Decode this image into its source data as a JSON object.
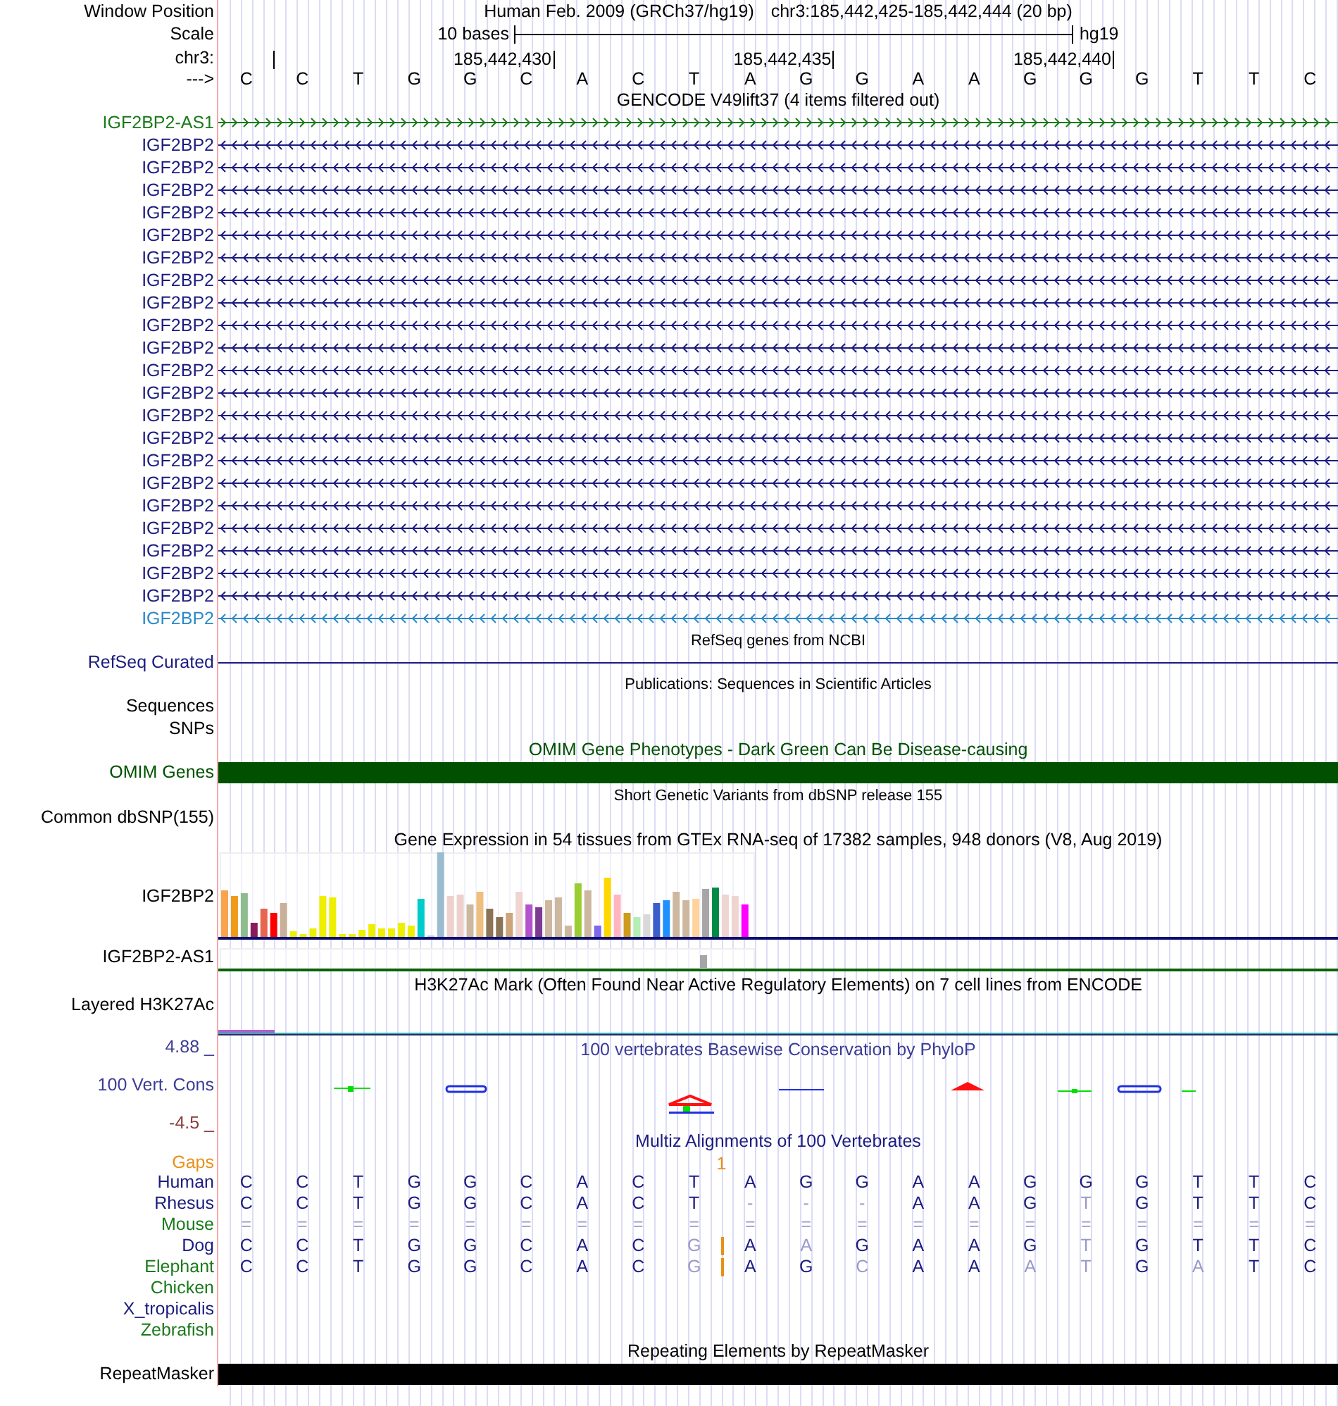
{
  "header": {
    "window_position": {
      "label": "Window Position",
      "assembly": "Human Feb. 2009 (GRCh37/hg19)",
      "position": "chr3:185,442,425-185,442,444 (20 bp)"
    },
    "scale": {
      "label": "Scale",
      "span": "10 bases",
      "assembly": "hg19"
    },
    "chromosome": {
      "label": "chr3:",
      "ticks": [
        "185,442,430",
        "185,442,435",
        "185,442,440"
      ]
    },
    "sequence": {
      "label": "--->",
      "bases": [
        "C",
        "C",
        "T",
        "G",
        "G",
        "C",
        "A",
        "C",
        "T",
        "A",
        "G",
        "G",
        "A",
        "A",
        "G",
        "G",
        "G",
        "T",
        "T",
        "C"
      ]
    }
  },
  "tracks": [
    {
      "kind": "genes",
      "title": "GENCODE V49lift37 (4 items filtered out)",
      "items": [
        {
          "name": "IGF2BP2-AS1",
          "reverse": false,
          "color": "#1a7a1a"
        },
        {
          "name": "IGF2BP2",
          "reverse": true,
          "color": "#1c1c80"
        },
        {
          "name": "IGF2BP2",
          "reverse": true,
          "color": "#1c1c80"
        },
        {
          "name": "IGF2BP2",
          "reverse": true,
          "color": "#1c1c80"
        },
        {
          "name": "IGF2BP2",
          "reverse": true,
          "color": "#1c1c80"
        },
        {
          "name": "IGF2BP2",
          "reverse": true,
          "color": "#1c1c80"
        },
        {
          "name": "IGF2BP2",
          "reverse": true,
          "color": "#1c1c80"
        },
        {
          "name": "IGF2BP2",
          "reverse": true,
          "color": "#1c1c80"
        },
        {
          "name": "IGF2BP2",
          "reverse": true,
          "color": "#1c1c80"
        },
        {
          "name": "IGF2BP2",
          "reverse": true,
          "color": "#1c1c80"
        },
        {
          "name": "IGF2BP2",
          "reverse": true,
          "color": "#1c1c80"
        },
        {
          "name": "IGF2BP2",
          "reverse": true,
          "color": "#1c1c80"
        },
        {
          "name": "IGF2BP2",
          "reverse": true,
          "color": "#1c1c80"
        },
        {
          "name": "IGF2BP2",
          "reverse": true,
          "color": "#1c1c80"
        },
        {
          "name": "IGF2BP2",
          "reverse": true,
          "color": "#1c1c80"
        },
        {
          "name": "IGF2BP2",
          "reverse": true,
          "color": "#1c1c80"
        },
        {
          "name": "IGF2BP2",
          "reverse": true,
          "color": "#1c1c80"
        },
        {
          "name": "IGF2BP2",
          "reverse": true,
          "color": "#1c1c80"
        },
        {
          "name": "IGF2BP2",
          "reverse": true,
          "color": "#1c1c80"
        },
        {
          "name": "IGF2BP2",
          "reverse": true,
          "color": "#1c1c80"
        },
        {
          "name": "IGF2BP2",
          "reverse": true,
          "color": "#1c1c80"
        },
        {
          "name": "IGF2BP2",
          "reverse": true,
          "color": "#1c1c80"
        },
        {
          "name": "IGF2BP2",
          "reverse": true,
          "color": "#2a8ac8"
        }
      ]
    },
    {
      "kind": "line",
      "title": "RefSeq genes from NCBI",
      "label": "RefSeq Curated"
    },
    {
      "kind": "empty",
      "title": "Publications: Sequences in Scientific Articles",
      "labels": [
        "Sequences",
        "SNPs"
      ]
    },
    {
      "kind": "bar",
      "title": "OMIM Gene Phenotypes - Dark Green Can Be Disease-causing",
      "label": "OMIM Genes",
      "color": "#005000"
    },
    {
      "kind": "empty",
      "title": "Short Genetic Variants from dbSNP release 155",
      "labels": [
        "Common dbSNP(155)"
      ]
    },
    {
      "kind": "expression",
      "title": "Gene Expression in 54 tissues from GTEx RNA-seq of 17382 samples, 948 donors (V8, Aug 2019)",
      "rows": [
        "IGF2BP2",
        "IGF2BP2-AS1"
      ]
    },
    {
      "kind": "layered",
      "title": "H3K27Ac Mark (Often Found Near Active Regulatory Elements) on 7 cell lines from ENCODE",
      "label": "Layered H3K27Ac"
    },
    {
      "kind": "conservation",
      "title": "100 vertebrates Basewise Conservation by PhyloP",
      "label": "100 Vert. Cons",
      "max": "4.88 _",
      "min": "-4.5 _"
    },
    {
      "kind": "multiz",
      "title": "Multiz Alignments of 100 Vertebrates",
      "gaps": {
        "label": "Gaps",
        "mark": "1"
      },
      "species": [
        {
          "name": "Human",
          "color": "#1c1c80",
          "insertion": false,
          "bases": [
            "C",
            "C",
            "T",
            "G",
            "G",
            "C",
            "A",
            "C",
            "T",
            "A",
            "G",
            "G",
            "A",
            "A",
            "G",
            "G",
            "G",
            "T",
            "T",
            "C"
          ],
          "faded": [
            false,
            false,
            false,
            false,
            false,
            false,
            false,
            false,
            false,
            false,
            false,
            false,
            false,
            false,
            false,
            false,
            false,
            false,
            false,
            false
          ]
        },
        {
          "name": "Rhesus",
          "color": "#1c1c80",
          "insertion": false,
          "bases": [
            "C",
            "C",
            "T",
            "G",
            "G",
            "C",
            "A",
            "C",
            "T",
            "-",
            "-",
            "-",
            "A",
            "A",
            "G",
            "T",
            "G",
            "T",
            "T",
            "C"
          ],
          "faded": [
            false,
            false,
            false,
            false,
            false,
            false,
            false,
            false,
            false,
            true,
            true,
            true,
            false,
            false,
            false,
            true,
            false,
            false,
            false,
            false
          ]
        },
        {
          "name": "Mouse",
          "color": "#1a7a1a",
          "insertion": false,
          "bases": [
            "=",
            "=",
            "=",
            "=",
            "=",
            "=",
            "=",
            "=",
            "=",
            "=",
            "=",
            "=",
            "=",
            "=",
            "=",
            "=",
            "=",
            "=",
            "=",
            "="
          ],
          "faded": [
            true,
            true,
            true,
            true,
            true,
            true,
            true,
            true,
            true,
            true,
            true,
            true,
            true,
            true,
            true,
            true,
            true,
            true,
            true,
            true
          ]
        },
        {
          "name": "Dog",
          "color": "#1c1c80",
          "insertion": true,
          "bases": [
            "C",
            "C",
            "T",
            "G",
            "G",
            "C",
            "A",
            "C",
            "G",
            "A",
            "A",
            "G",
            "A",
            "A",
            "G",
            "T",
            "G",
            "T",
            "T",
            "C"
          ],
          "faded": [
            false,
            false,
            false,
            false,
            false,
            false,
            false,
            false,
            true,
            false,
            true,
            false,
            false,
            false,
            false,
            true,
            false,
            false,
            false,
            false
          ]
        },
        {
          "name": "Elephant",
          "color": "#1a7a1a",
          "insertion": true,
          "bases": [
            "C",
            "C",
            "T",
            "G",
            "G",
            "C",
            "A",
            "C",
            "G",
            "A",
            "G",
            "C",
            "A",
            "A",
            "A",
            "T",
            "G",
            "A",
            "T",
            "C"
          ],
          "faded": [
            false,
            false,
            false,
            false,
            false,
            false,
            false,
            false,
            true,
            false,
            false,
            true,
            false,
            false,
            true,
            true,
            false,
            true,
            false,
            false
          ]
        },
        {
          "name": "Chicken",
          "color": "#1a7a1a",
          "insertion": false
        },
        {
          "name": "X_tropicalis",
          "color": "#1c1c80",
          "insertion": false
        },
        {
          "name": "Zebrafish",
          "color": "#1a7a1a",
          "insertion": false
        }
      ]
    },
    {
      "kind": "bar",
      "title": "Repeating Elements by RepeatMasker",
      "label": "RepeatMasker",
      "color": "#000000"
    }
  ]
}
